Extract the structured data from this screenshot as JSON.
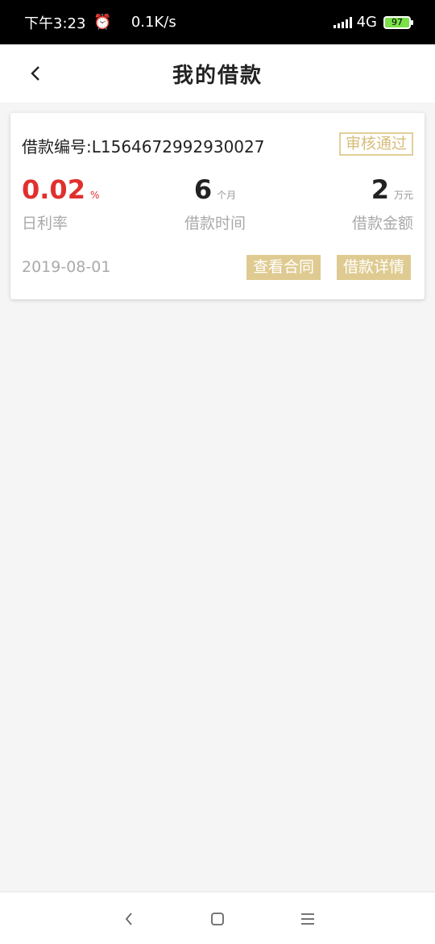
{
  "status_bar": {
    "time": "下午3:23",
    "speed": "0.1K/s",
    "network": "4G",
    "battery": "97"
  },
  "header": {
    "title": "我的借款"
  },
  "loan": {
    "number_label": "借款编号:L1564672992930027",
    "status": "审核通过",
    "rate_value": "0.02",
    "rate_unit": "%",
    "rate_label": "日利率",
    "term_value": "6",
    "term_unit": "个月",
    "term_label": "借款时间",
    "amount_value": "2",
    "amount_unit": "万元",
    "amount_label": "借款金额",
    "date": "2019-08-01",
    "contract_button": "查看合同",
    "detail_button": "借款详情"
  },
  "colors": {
    "accent_gold": "#dfcb91",
    "rate_red": "#e0302e"
  }
}
